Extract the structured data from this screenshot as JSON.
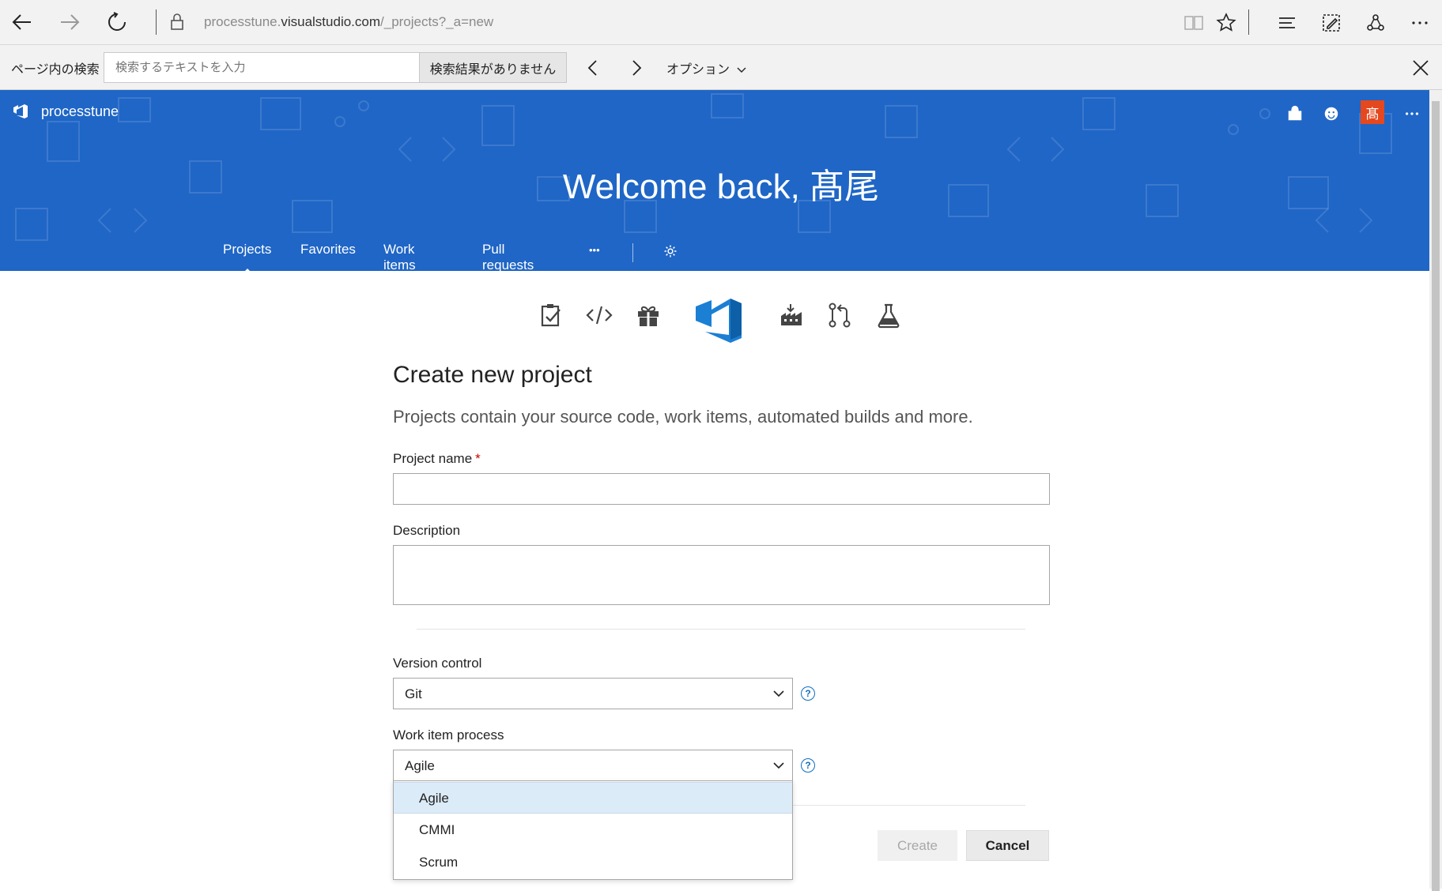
{
  "browser": {
    "url_prefix": "processtune.",
    "url_host": "visualstudio.com",
    "url_path": "/_projects?_a=new"
  },
  "findbar": {
    "label": "ページ内の検索",
    "placeholder": "検索するテキストを入力",
    "result": "検索結果がありません",
    "options": "オプション"
  },
  "header": {
    "brand": "processtune",
    "avatar_initial": "髙",
    "welcome": "Welcome back, 髙尾",
    "tabs": [
      "Projects",
      "Favorites",
      "Work items",
      "Pull requests",
      "•••"
    ]
  },
  "form": {
    "title": "Create new project",
    "subtitle": "Projects contain your source code, work items, automated builds and more.",
    "project_name_label": "Project name",
    "required_mark": "*",
    "description_label": "Description",
    "version_control_label": "Version control",
    "version_control_value": "Git",
    "process_label": "Work item process",
    "process_value": "Agile",
    "process_options": [
      "Agile",
      "CMMI",
      "Scrum"
    ],
    "help_mark": "?",
    "create_button": "Create",
    "cancel_button": "Cancel"
  },
  "colors": {
    "banner": "#1f66c6",
    "accent": "#106ebe",
    "avatar": "#e5481e"
  }
}
